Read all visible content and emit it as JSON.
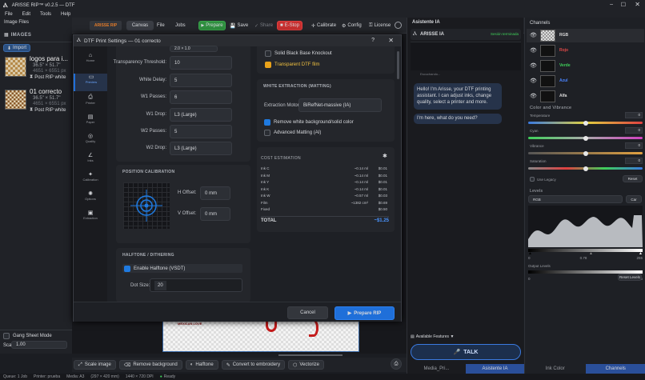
{
  "app": {
    "title": "ARISSE RIP™ v0.2.5 — DTF",
    "menu": [
      "File",
      "Edit",
      "Tools",
      "Help"
    ]
  },
  "toolbar": {
    "logo": "ARISSE RIP",
    "tabs": [
      "Canvas",
      "File",
      "Jobs"
    ],
    "prepare": "Prepare",
    "save": "Save",
    "share": "Share",
    "estop": "E-Stop",
    "calibrate": "Calibrate",
    "config": "Config",
    "license": "License"
  },
  "left": {
    "header": "Image Files",
    "images_title": "IMAGES",
    "import": "Import",
    "files": [
      {
        "name": "logos para i...",
        "size": "36.5\" × 51.7\"",
        "px": "4651 × 6551 px",
        "status": "Post RIP white"
      },
      {
        "name": "01 correcto",
        "size": "36.5\" × 51.7\"",
        "px": "4651 × 6551 px",
        "status": "Post RIP white"
      }
    ],
    "gang_mode": "Gang Sheet Mode",
    "scale_label": "Scale",
    "scale_value": "1.00"
  },
  "dialog": {
    "title": "DTF Print Settings — 01 correcto",
    "nav": [
      "Home",
      "Preview",
      "Printer",
      "Paper",
      "Quality",
      "Inks",
      "Calibration",
      "Options",
      "Extraction"
    ],
    "top_field": "2.0 × 1.0",
    "rows": [
      {
        "label": "Transparency Threshold:",
        "value": "10"
      },
      {
        "label": "White Delay:",
        "value": "5"
      },
      {
        "label": "W1 Passes:",
        "value": "6"
      },
      {
        "label": "W1 Drop:",
        "value": "L3 (Large)"
      },
      {
        "label": "W2 Passes:",
        "value": "5"
      },
      {
        "label": "W2 Drop:",
        "value": "L3 (Large)"
      }
    ],
    "position_title": "POSITION CALIBRATION",
    "h_offset_label": "H Offset:",
    "h_offset": "0 mm",
    "v_offset_label": "V Offset:",
    "v_offset": "0 mm",
    "halftone_title": "HALFTONE / DITHERING",
    "halftone_label": "Enable Halftone (VSDT)",
    "dot_size_label": "Dot Size:",
    "dot_size": "20",
    "knockout": "Solid Black Base Knockout",
    "transparent": "Transparent DTF film",
    "white_title": "WHITE EXTRACTION (MATTING)",
    "engine_label": "Extraction Motor:",
    "engine_value": "BiRefNet-massive (IA)",
    "remove_bg": "Remove white background/solid color",
    "adv_matting": "Advanced Matting (AI)",
    "cost_title": "COST ESTIMATION",
    "cost_rows": [
      {
        "name": "Ink C",
        "qty": "~0.14 ml",
        "price": "$0.01"
      },
      {
        "name": "Ink M",
        "qty": "~0.14 ml",
        "price": "$0.01"
      },
      {
        "name": "Ink Y",
        "qty": "~0.14 ml",
        "price": "$0.01"
      },
      {
        "name": "Ink K",
        "qty": "~0.14 ml",
        "price": "$0.01"
      },
      {
        "name": "Ink W",
        "qty": "~0.57 ml",
        "price": "$0.03"
      },
      {
        "name": "Film",
        "qty": "~1382 cm²",
        "price": "$0.69"
      },
      {
        "name": "Fixed",
        "qty": "",
        "price": "$0.50"
      }
    ],
    "total_label": "TOTAL",
    "total_value": "~$1.25",
    "cancel": "Cancel",
    "prepare_rip": "Prepare RIP"
  },
  "canvas_text": "MEXICAN LOVE",
  "bottom_tools": [
    "Scale image",
    "Remove background",
    "Halftone",
    "Convert to embroidery",
    "Vectorize"
  ],
  "status": {
    "queue": "Queue: 1 Job",
    "printer": "Printer: prueba",
    "media": "Media: A3",
    "dims": "(297 × 420 mm)",
    "res": "1440 × 720 DPI",
    "ready": "Ready"
  },
  "assistant": {
    "tab": "Asistente IA",
    "name": "ARISSE IA",
    "badge": "Sesión terminada",
    "input_placeholder": "Escuchando...",
    "msg1": "Hello! I'm Arisse, your DTF printing assistant. I can adjust inks, change quality, select a printer and more.",
    "msg2": "I'm here, what do you need?",
    "features": "Available Features ▼",
    "talk": "TALK",
    "bottom_tabs": [
      "Media_Pri...",
      "Asistente IA"
    ]
  },
  "right": {
    "channels_title": "Channels",
    "channels": [
      {
        "name": "RGB",
        "color": "#d8d8d8"
      },
      {
        "name": "Rojo",
        "color": "#e04848"
      },
      {
        "name": "Verde",
        "color": "#3fcf5a"
      },
      {
        "name": "Azul",
        "color": "#4a84ff"
      },
      {
        "name": "Alfa",
        "color": "#d8d8d8"
      }
    ],
    "color_title": "Color and Vibrance",
    "sliders": [
      {
        "label": "Temperature",
        "value": "0",
        "pos": 0.5
      },
      {
        "label": "Cyan",
        "value": "0",
        "pos": 0.5
      },
      {
        "label": "Vibrance",
        "value": "0",
        "pos": 0.5
      },
      {
        "label": "Saturation",
        "value": "0",
        "pos": 0.5
      }
    ],
    "use_legacy": "Use Legacy",
    "reset": "Reset",
    "levels_title": "Levels",
    "levels_channel": "RGB",
    "auto": "Car",
    "levels_values": [
      "0",
      "0.78",
      "255"
    ],
    "output_title": "Output Levels",
    "output_values": [
      "0",
      "255"
    ],
    "reset_levels": "Reset Levels",
    "bottom_tabs": [
      "Ink Color",
      "Channels"
    ]
  },
  "colors": {
    "accent": "#1f6fd9",
    "stop": "#d33030",
    "prepare": "#2f8f3f"
  }
}
